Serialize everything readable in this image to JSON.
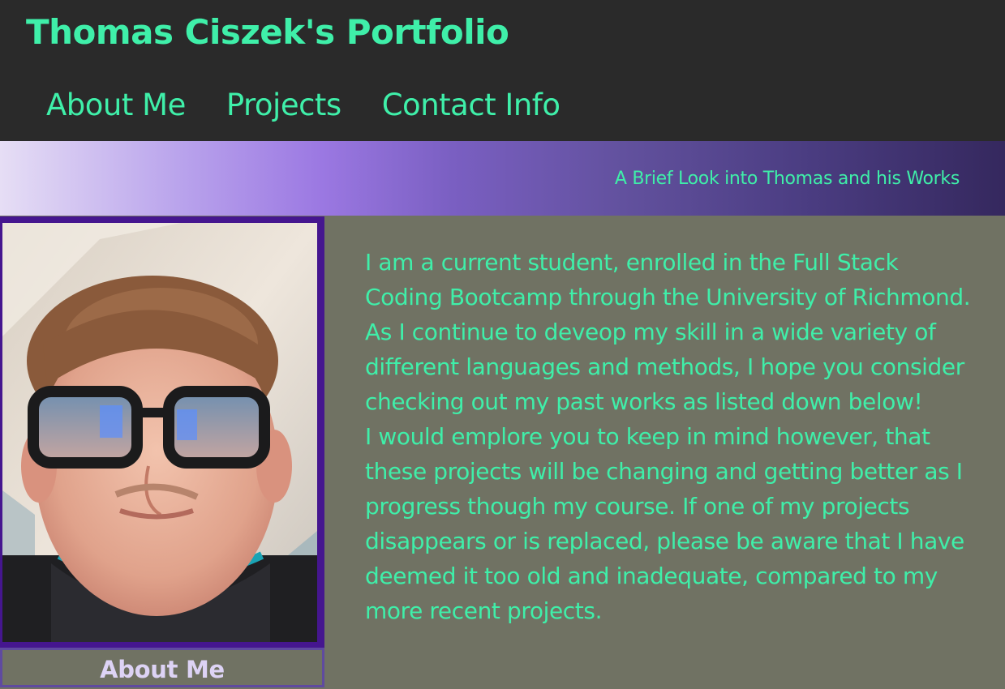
{
  "header": {
    "title": "Thomas Ciszek's Portfolio",
    "nav": [
      {
        "label": "About Me"
      },
      {
        "label": "Projects"
      },
      {
        "label": "Contact Info"
      }
    ]
  },
  "banner": {
    "tagline": "A Brief Look into Thomas and his Works"
  },
  "about": {
    "caption": "About Me",
    "paragraphs": [
      "I am a current student, enrolled in the Full Stack Coding Bootcamp through the University of Richmond. As I continue to deveop my skill in a wide variety of different languages and methods, I hope you consider checking out my past works as listed down below!",
      "I would emplore you to keep in mind however, that these projects will be changing and getting better as I progress though my course. If one of my projects disappears or is replaced, please be aware that I have deemed it too old and inadequate, compared to my more recent projects."
    ]
  },
  "colors": {
    "accent": "#3fefa9",
    "header_bg": "#2a2a2a",
    "content_bg": "#707263",
    "photo_border": "#45168f",
    "caption_text": "#ddd3f5"
  }
}
